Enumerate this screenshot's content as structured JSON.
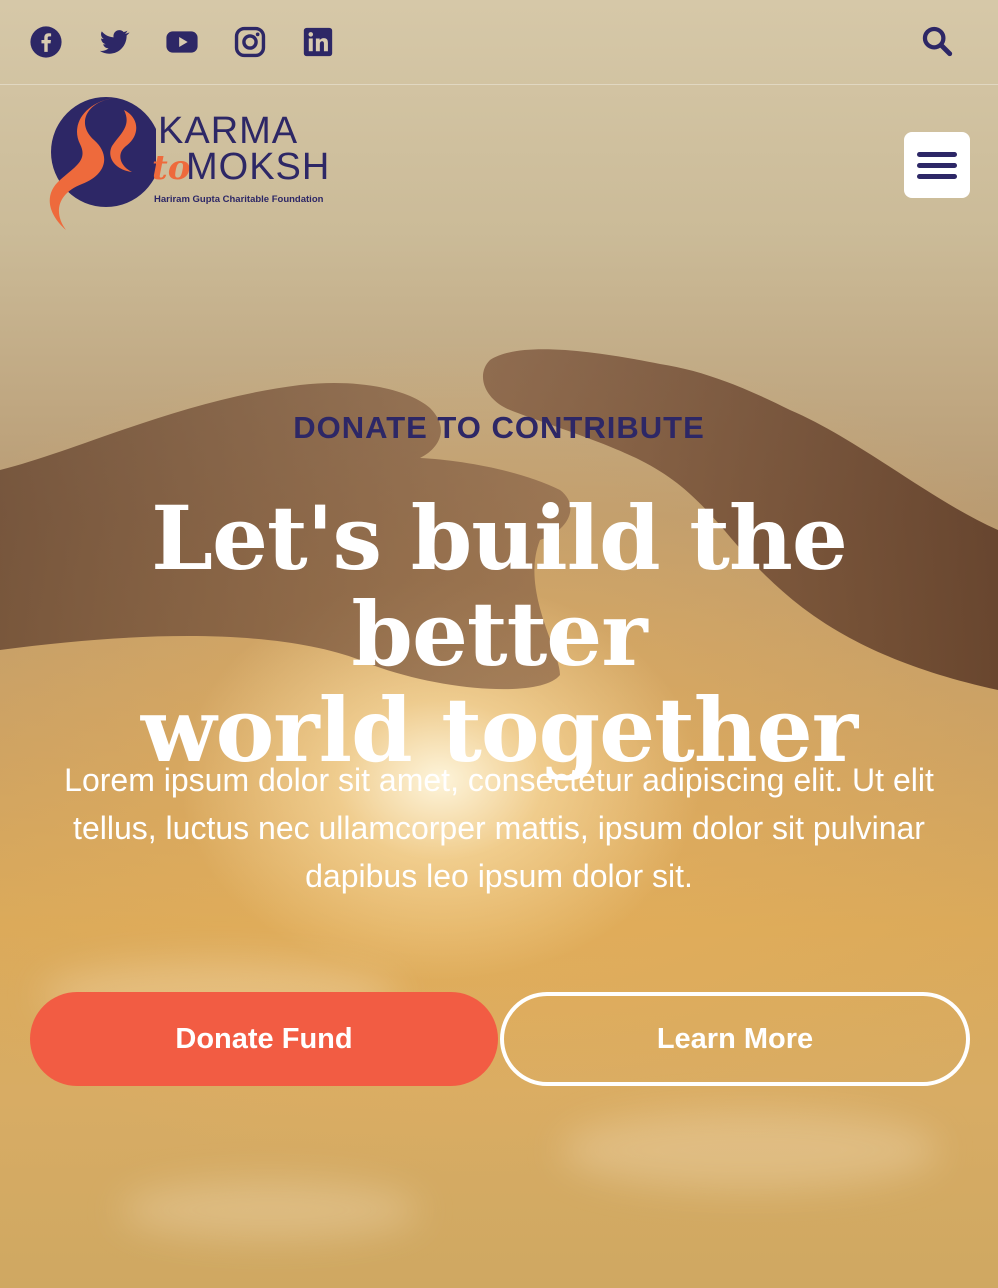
{
  "social": [
    {
      "name": "facebook",
      "icon": "facebook-icon"
    },
    {
      "name": "twitter",
      "icon": "twitter-icon"
    },
    {
      "name": "youtube",
      "icon": "youtube-icon"
    },
    {
      "name": "instagram",
      "icon": "instagram-icon"
    },
    {
      "name": "linkedin",
      "icon": "linkedin-icon"
    }
  ],
  "search_icon": "search-icon",
  "logo": {
    "line1": "KARMA",
    "to": "to",
    "line2": "MOKSH",
    "tagline": "Hariram Gupta Charitable Foundation"
  },
  "menu_icon": "hamburger-menu-icon",
  "hero": {
    "eyebrow": "DONATE TO CONTRIBUTE",
    "headline_line1": "Let's build the better",
    "headline_line2": "world together",
    "body": "Lorem ipsum dolor sit amet, consectetur adipiscing elit. Ut elit tellus, luctus nec ullamcorper mattis, ipsum dolor sit pulvinar dapibus leo ipsum dolor sit.",
    "primary_button": "Donate Fund",
    "secondary_button": "Learn More"
  },
  "colors": {
    "brand_navy": "#2d2766",
    "brand_orange": "#ee6a3c",
    "donate_button": "#f25c43",
    "text_on_hero": "#ffffff"
  }
}
